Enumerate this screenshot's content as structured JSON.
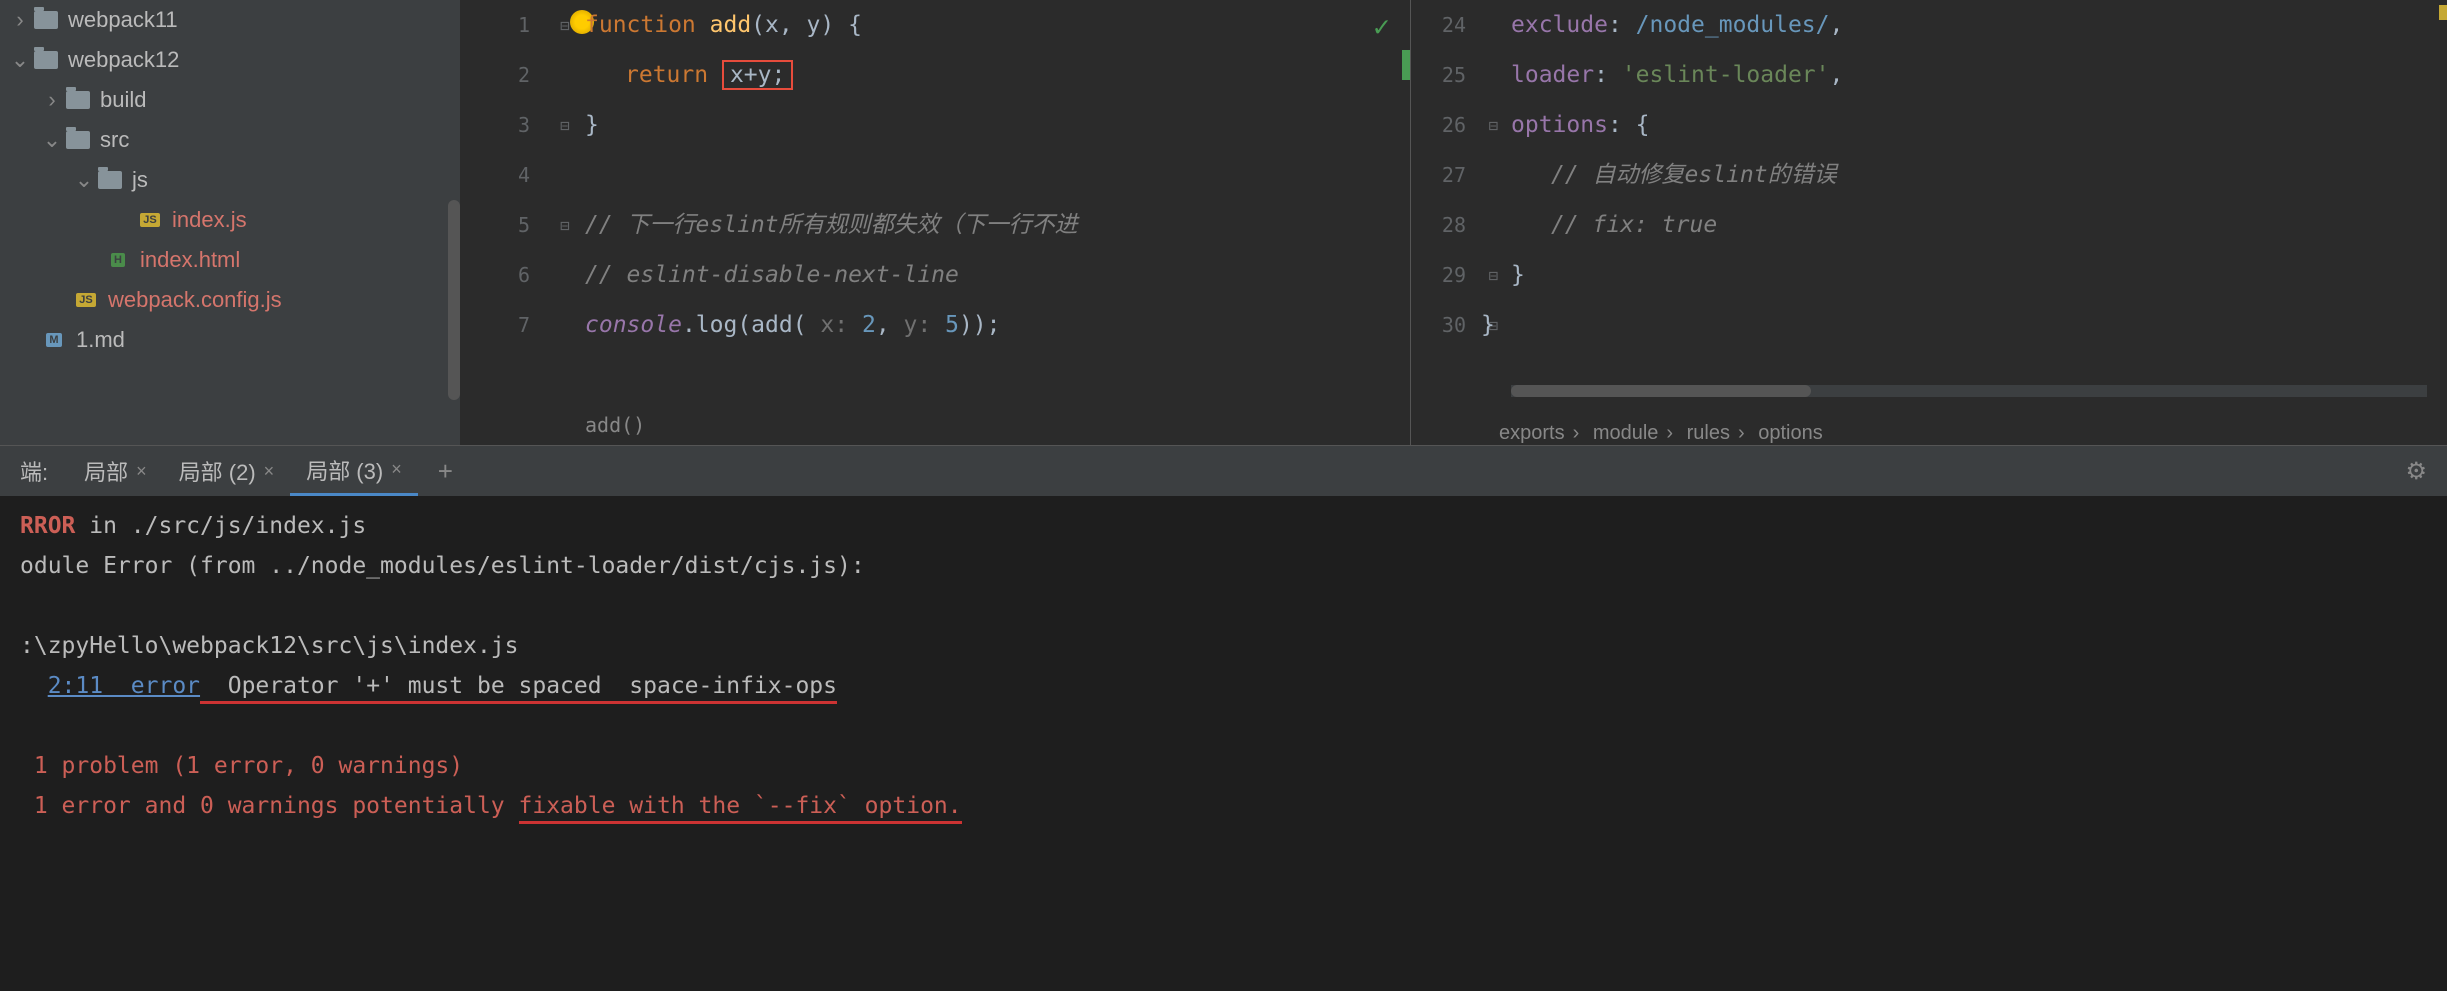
{
  "sidebar": {
    "items": [
      {
        "name": "webpack11",
        "type": "folder",
        "expanded": false,
        "indent": 0
      },
      {
        "name": "webpack12",
        "type": "folder",
        "expanded": true,
        "indent": 0
      },
      {
        "name": "build",
        "type": "folder",
        "expanded": false,
        "indent": 1
      },
      {
        "name": "src",
        "type": "folder",
        "expanded": true,
        "indent": 1
      },
      {
        "name": "js",
        "type": "folder",
        "expanded": true,
        "indent": 2
      },
      {
        "name": "index.js",
        "type": "js",
        "accent": true,
        "indent": 4
      },
      {
        "name": "index.html",
        "type": "html",
        "accent": true,
        "indent": 3
      },
      {
        "name": "webpack.config.js",
        "type": "js",
        "accent": true,
        "indent": 2
      },
      {
        "name": "1.md",
        "type": "md",
        "accent": false,
        "indent": 1
      }
    ]
  },
  "editor_left": {
    "gutter": [
      "1",
      "2",
      "3",
      "4",
      "5",
      "6",
      "7"
    ],
    "lines": {
      "l1": {
        "kw": "function",
        "fn": " add",
        "rest": "(x, y) {"
      },
      "l2": {
        "kw": "return ",
        "boxed": "x+y;"
      },
      "l3": "}",
      "l4": "",
      "l5": "// 下一行eslint所有规则都失效（下一行不进",
      "l6": "// eslint-disable-next-line",
      "l7": {
        "obj": "console",
        "method": ".log(add( ",
        "hint1": "x: ",
        "arg1": "2",
        "comma": ", ",
        "hint2": "y: ",
        "arg2": "5",
        "end": "));"
      }
    },
    "breadcrumb": "add()"
  },
  "editor_right": {
    "gutter": [
      "24",
      "25",
      "26",
      "27",
      "28",
      "29",
      "30"
    ],
    "lines": {
      "r24": {
        "prop": "exclude",
        "val": "/node_modules/",
        "post": ","
      },
      "r25": {
        "prop": "loader",
        "val": "'eslint-loader'",
        "post": ","
      },
      "r26": {
        "prop": "options",
        "val": "{"
      },
      "r27": "// 自动修复eslint的错误",
      "r28": "// fix: true",
      "r29": "}",
      "r30": "}"
    },
    "breadcrumb": [
      "exports",
      "module",
      "rules",
      "options"
    ]
  },
  "terminal": {
    "label": "端:",
    "tabs": [
      {
        "name": "局部",
        "active": false
      },
      {
        "name": "局部 (2)",
        "active": false
      },
      {
        "name": "局部 (3)",
        "active": true
      }
    ],
    "output": {
      "line1_err": "RROR",
      "line1_rest": " in ./src/js/index.js",
      "line2": "odule Error (from ../node_modules/eslint-loader/dist/cjs.js):",
      "line3": ":\\zpyHello\\webpack12\\src\\js\\index.js",
      "line4_link": "2:11  error",
      "line4_msg": "  Operator '+' must be spaced  space-infix-ops",
      "line5": " 1 problem (1 error, 0 warnings)",
      "line6_a": " 1 error and 0 warnings potentially ",
      "line6_b": "fixable with the `--fix` option."
    }
  }
}
